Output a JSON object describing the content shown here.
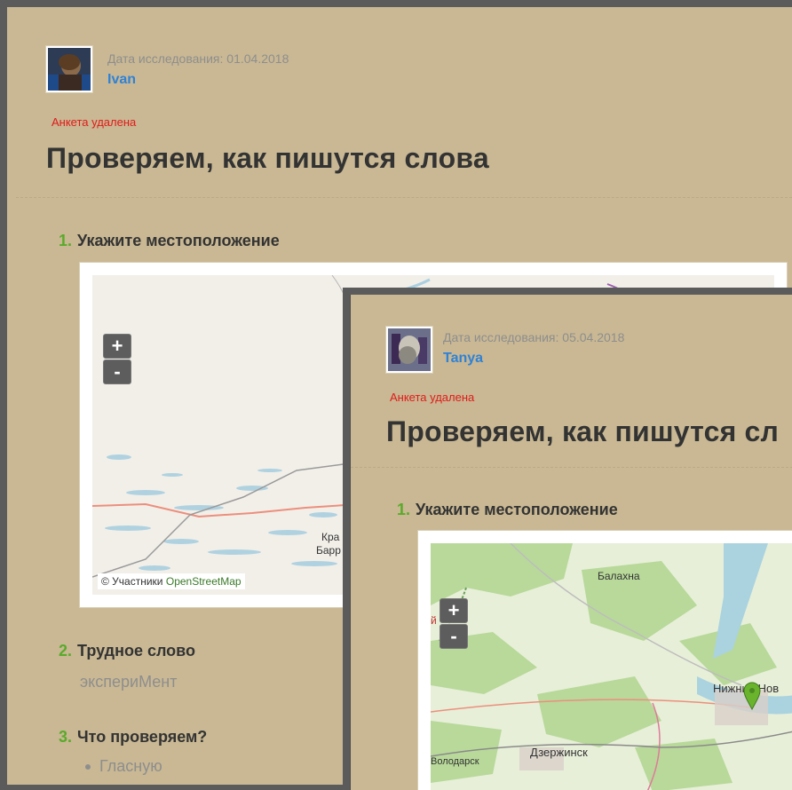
{
  "card1": {
    "date_label": "Дата исследования: 01.04.2018",
    "user": "Ivan",
    "deleted": "Анкета удалена",
    "title": "Проверяем, как пишутся слова",
    "questions": [
      {
        "num": "1.",
        "text": "Укажите местоположение"
      },
      {
        "num": "2.",
        "text": "Трудное слово"
      },
      {
        "num": "3.",
        "text": "Что проверяем?"
      }
    ],
    "answer2": "экспериМент",
    "answer3": "Гласную",
    "map": {
      "zoom_in": "+",
      "zoom_out": "-",
      "attribution_prefix": "© Участники",
      "attribution_link": "OpenStreetMap",
      "labels": [
        "Кра",
        "Барр"
      ]
    }
  },
  "card2": {
    "date_label": "Дата исследования: 05.04.2018",
    "user": "Tanya",
    "deleted": "Анкета удалена",
    "title": "Проверяем, как пишутся сл",
    "questions": [
      {
        "num": "1.",
        "text": "Укажите местоположение"
      }
    ],
    "map": {
      "zoom_in": "+",
      "zoom_out": "-",
      "labels": [
        "Балахна",
        "Нижний Нов",
        "Дзержинск",
        "Володарск",
        "Б",
        "й"
      ]
    }
  },
  "colors": {
    "background": "#c9b893",
    "accent_green": "#5aaa2c",
    "user_link": "#2f82d6",
    "deleted_red": "#e01b1b",
    "frame": "#5b5b5c"
  }
}
